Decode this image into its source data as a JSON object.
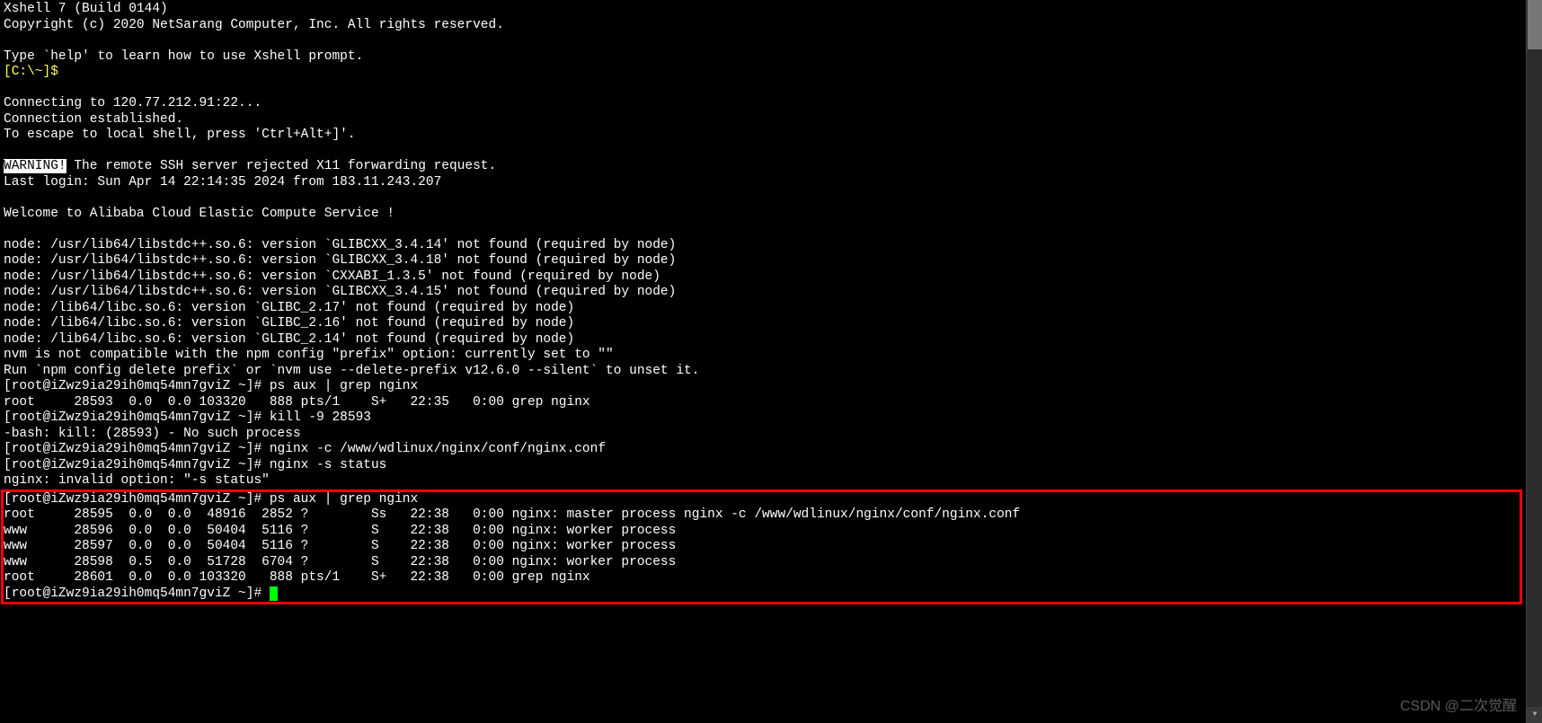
{
  "header1": "Xshell 7 (Build 0144)",
  "header2": "Copyright (c) 2020 NetSarang Computer, Inc. All rights reserved.",
  "help": "Type `help' to learn how to use Xshell prompt.",
  "localPrompt": "[C:\\~]$",
  "conn1": "Connecting to 120.77.212.91:22...",
  "conn2": "Connection established.",
  "conn3": "To escape to local shell, press 'Ctrl+Alt+]'.",
  "warnLabel": "WARNING!",
  "warnText": " The remote SSH server rejected X11 forwarding request.",
  "lastLogin": "Last login: Sun Apr 14 22:14:35 2024 from 183.11.243.207",
  "welcome": "Welcome to Alibaba Cloud Elastic Compute Service !",
  "err1": "node: /usr/lib64/libstdc++.so.6: version `GLIBCXX_3.4.14' not found (required by node)",
  "err2": "node: /usr/lib64/libstdc++.so.6: version `GLIBCXX_3.4.18' not found (required by node)",
  "err3": "node: /usr/lib64/libstdc++.so.6: version `CXXABI_1.3.5' not found (required by node)",
  "err4": "node: /usr/lib64/libstdc++.so.6: version `GLIBCXX_3.4.15' not found (required by node)",
  "err5": "node: /lib64/libc.so.6: version `GLIBC_2.17' not found (required by node)",
  "err6": "node: /lib64/libc.so.6: version `GLIBC_2.16' not found (required by node)",
  "err7": "node: /lib64/libc.so.6: version `GLIBC_2.14' not found (required by node)",
  "nvm1": "nvm is not compatible with the npm config \"prefix\" option: currently set to \"\"",
  "nvm2": "Run `npm config delete prefix` or `nvm use --delete-prefix v12.6.0 --silent` to unset it.",
  "prompt": "[root@iZwz9ia29ih0mq54mn7gviZ ~]# ",
  "cmd1": "ps aux | grep nginx",
  "out1": "root     28593  0.0  0.0 103320   888 pts/1    S+   22:35   0:00 grep nginx",
  "cmd2": "kill -9 28593",
  "out2": "-bash: kill: (28593) - No such process",
  "cmd3": "nginx -c /www/wdlinux/nginx/conf/nginx.conf",
  "cmd4": "nginx -s status",
  "out4": "nginx: invalid option: \"-s status\"",
  "boxCmd": "ps aux | grep nginx",
  "boxRow1": "root     28595  0.0  0.0  48916  2852 ?        Ss   22:38   0:00 nginx: master process nginx -c /www/wdlinux/nginx/conf/nginx.conf",
  "boxRow2": "www      28596  0.0  0.0  50404  5116 ?        S    22:38   0:00 nginx: worker process",
  "boxRow3": "www      28597  0.0  0.0  50404  5116 ?        S    22:38   0:00 nginx: worker process",
  "boxRow4": "www      28598  0.5  0.0  51728  6704 ?        S    22:38   0:00 nginx: worker process",
  "boxRow5": "root     28601  0.0  0.0 103320   888 pts/1    S+   22:38   0:00 grep nginx",
  "watermark": "CSDN @二次觉醒"
}
